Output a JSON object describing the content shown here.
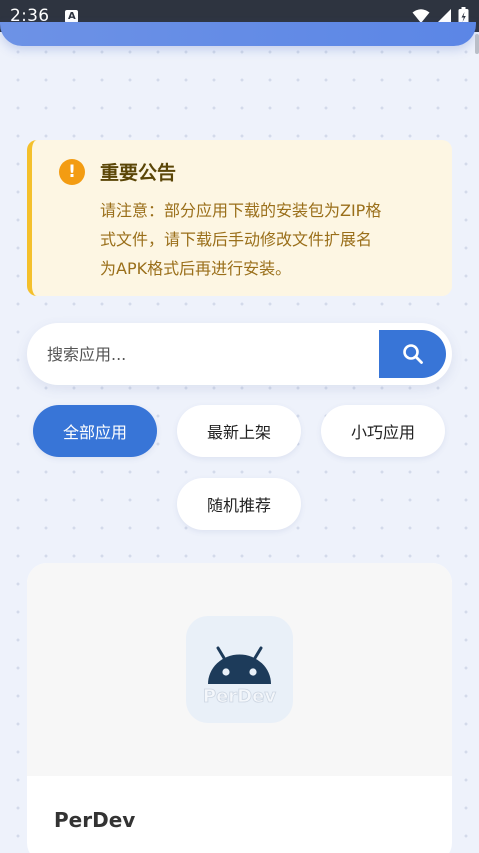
{
  "status_bar": {
    "time": "2:36",
    "a_badge": "A"
  },
  "notice": {
    "icon_name": "warning-icon",
    "icon_glyph": "!",
    "title": "重要公告",
    "lines": [
      "请注意：部分应用下载的安装包为ZIP格",
      "式文件，请下载后手动修改文件扩展名",
      "为APK格式后再进行安装。"
    ]
  },
  "search": {
    "placeholder": "搜索应用...",
    "value": ""
  },
  "filters": [
    {
      "label": "全部应用",
      "active": true
    },
    {
      "label": "最新上架",
      "active": false
    },
    {
      "label": "小巧应用",
      "active": false
    },
    {
      "label": "随机推荐",
      "active": false
    }
  ],
  "app_card": {
    "name": "PerDev",
    "icon_watermark": "PerDev"
  },
  "colors": {
    "accent": "#3875d7",
    "warning": "#f39c12",
    "notice_bg": "#fdf6e3",
    "notice_border": "#f4c02b"
  }
}
